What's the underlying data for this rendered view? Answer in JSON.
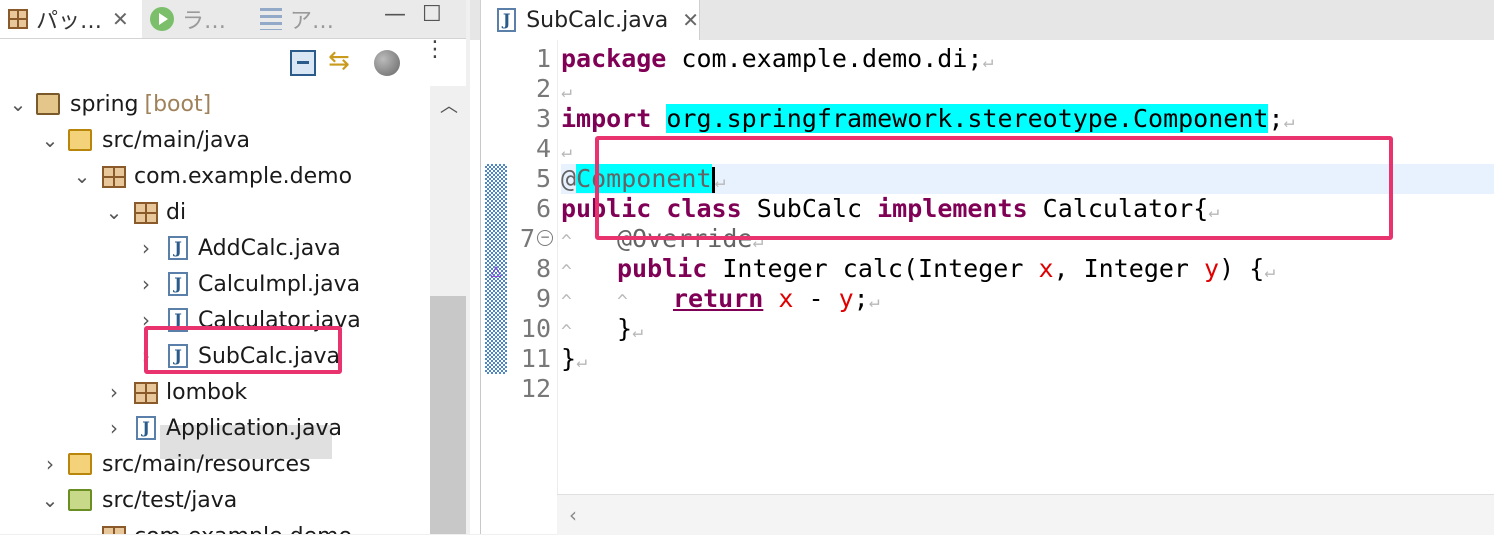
{
  "left_panel": {
    "tabs": [
      {
        "label": "パッ…",
        "icon": "package-explorer-icon",
        "active": true
      },
      {
        "label": "ラ…",
        "icon": "run-icon",
        "active": false
      },
      {
        "label": "ア…",
        "icon": "outline-icon",
        "active": false
      }
    ],
    "close_glyph": "✕",
    "minimize_glyph": "—",
    "maximize_glyph": "☐",
    "tree": [
      {
        "label": "spring",
        "suffix": "[boot]",
        "icon": "spring-boot-project-icon",
        "expanded": true
      },
      {
        "label": "src/main/java",
        "icon": "source-folder-icon",
        "expanded": true
      },
      {
        "label": "com.example.demo",
        "icon": "package-icon",
        "expanded": true
      },
      {
        "label": "di",
        "icon": "package-icon",
        "expanded": true
      },
      {
        "label": "AddCalc.java",
        "icon": "java-file-icon",
        "expanded": false
      },
      {
        "label": "CalcuImpl.java",
        "icon": "java-file-icon",
        "expanded": false
      },
      {
        "label": "Calculator.java",
        "icon": "java-file-icon",
        "expanded": false
      },
      {
        "label": "SubCalc.java",
        "icon": "java-file-icon",
        "expanded": false,
        "selected": true
      },
      {
        "label": "lombok",
        "icon": "package-icon",
        "expanded": false
      },
      {
        "label": "Application.java",
        "icon": "java-file-icon",
        "expanded": false
      },
      {
        "label": "src/main/resources",
        "icon": "source-folder-icon",
        "expanded": false
      },
      {
        "label": "src/test/java",
        "icon": "test-source-folder-icon",
        "expanded": true
      },
      {
        "label": "com.example.demo",
        "icon": "package-icon",
        "expanded": true
      }
    ]
  },
  "editor": {
    "tab_label": "SubCalc.java",
    "line_numbers": [
      "1",
      "2",
      "3",
      "4",
      "5",
      "6",
      "7",
      "8",
      "9",
      "10",
      "11",
      "12"
    ],
    "code": {
      "l1_kw": "package",
      "l1_text": " com.example.demo.di;",
      "l3_kw": "import",
      "l3_import": "org.springframework.stereotype.Component",
      "l3_semi": ";",
      "l5_at": "@",
      "l5_anno": "Component",
      "l6_kw1": "public",
      "l6_kw2": "class",
      "l6_name": " SubCalc ",
      "l6_kw3": "implements",
      "l6_rest": " Calculator{",
      "l7_anno": "@Override",
      "l8_kw": "public",
      "l8_t1": " Integer calc(Integer ",
      "l8_x": "x",
      "l8_t2": ", Integer ",
      "l8_y": "y",
      "l8_t3": ") {",
      "l9_kw": "return",
      "l9_x": "x",
      "l9_minus": " - ",
      "l9_y": "y",
      "l9_semi": ";",
      "l10": "}",
      "l11": "}"
    },
    "pilcrow": "↵",
    "indent_mark": "^"
  },
  "colors": {
    "keyword": "#7f0055",
    "highlight": "#00ffff",
    "annotation_box": "#e8336e"
  }
}
